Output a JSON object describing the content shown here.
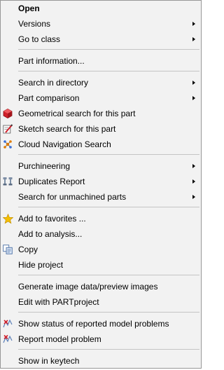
{
  "menu": {
    "items": [
      {
        "label": "Open",
        "bold": true,
        "icon": null,
        "submenu": false
      },
      {
        "label": "Versions",
        "icon": null,
        "submenu": true
      },
      {
        "label": "Go to class",
        "icon": null,
        "submenu": true
      },
      {
        "label": "Part information...",
        "icon": null,
        "submenu": false
      },
      {
        "label": "Search in directory",
        "icon": null,
        "submenu": true
      },
      {
        "label": "Part comparison",
        "icon": null,
        "submenu": true
      },
      {
        "label": "Geometrical search for this part",
        "icon": "geometric-search-icon",
        "submenu": false
      },
      {
        "label": "Sketch search for this part",
        "icon": "sketch-search-icon",
        "submenu": false
      },
      {
        "label": "Cloud Navigation Search",
        "icon": "cloud-navigation-icon",
        "submenu": false
      },
      {
        "label": "Purchineering",
        "icon": null,
        "submenu": true
      },
      {
        "label": "Duplicates Report",
        "icon": "duplicates-report-icon",
        "submenu": true
      },
      {
        "label": "Search for unmachined parts",
        "icon": null,
        "submenu": true
      },
      {
        "label": "Add to favorites ...",
        "icon": "star-icon",
        "submenu": false
      },
      {
        "label": "Add to analysis...",
        "icon": null,
        "submenu": false
      },
      {
        "label": "Copy",
        "icon": "copy-icon",
        "submenu": false
      },
      {
        "label": "Hide project",
        "icon": null,
        "submenu": false
      },
      {
        "label": "Generate image data/preview images",
        "icon": null,
        "submenu": false
      },
      {
        "label": "Edit with PARTproject",
        "icon": null,
        "submenu": false
      },
      {
        "label": "Show status of reported model problems",
        "icon": "model-problem-status-icon",
        "submenu": false
      },
      {
        "label": "Report model problem",
        "icon": "report-model-problem-icon",
        "submenu": false
      },
      {
        "label": "Show in keytech",
        "icon": null,
        "submenu": false
      }
    ]
  },
  "colors": {
    "background": "#f2f2f2",
    "border": "#979797",
    "separator": "#c4c4c4",
    "geometric_red": "#d0202a",
    "star_yellow": "#f5c000"
  }
}
